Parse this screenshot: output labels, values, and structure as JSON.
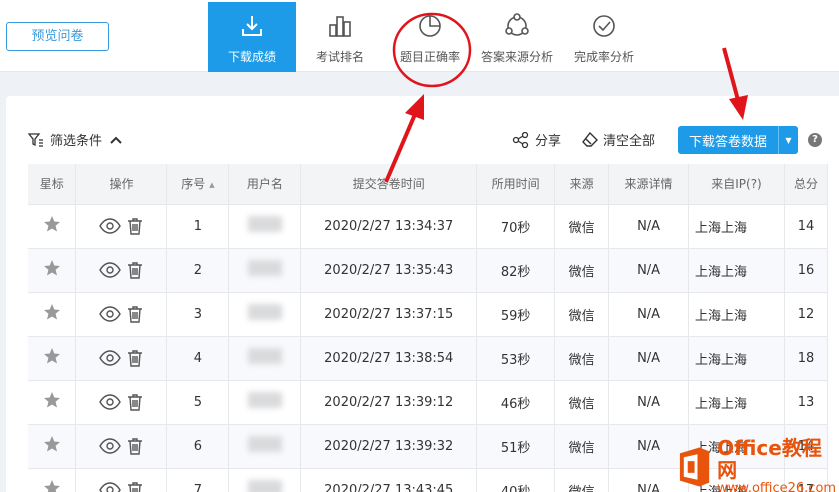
{
  "header": {
    "preview_button": "预览问卷",
    "tabs": [
      {
        "label": "下载成绩",
        "icon": "download-icon",
        "active": true
      },
      {
        "label": "考试排名",
        "icon": "ranking-bars-icon",
        "active": false
      },
      {
        "label": "题目正确率",
        "icon": "pie-chart-icon",
        "active": false
      },
      {
        "label": "答案来源分析",
        "icon": "share-nodes-icon",
        "active": false
      },
      {
        "label": "完成率分析",
        "icon": "check-circle-icon",
        "active": false
      }
    ]
  },
  "toolbar": {
    "filter_label": "筛选条件",
    "share_label": "分享",
    "clear_label": "清空全部",
    "download_label": "下载答卷数据",
    "help_label": "?"
  },
  "table": {
    "headers": [
      "星标",
      "操作",
      "序号",
      "用户名",
      "提交答卷时间",
      "所用时间",
      "来源",
      "来源详情",
      "来自IP(?)",
      "总分"
    ],
    "rows": [
      {
        "no": "1",
        "time": "2020/2/27 13:34:37",
        "used": "70秒",
        "source": "微信",
        "detail": "N/A",
        "ip": "上海上海",
        "score": "14"
      },
      {
        "no": "2",
        "time": "2020/2/27 13:35:43",
        "used": "82秒",
        "source": "微信",
        "detail": "N/A",
        "ip": "上海上海",
        "score": "16"
      },
      {
        "no": "3",
        "time": "2020/2/27 13:37:15",
        "used": "59秒",
        "source": "微信",
        "detail": "N/A",
        "ip": "上海上海",
        "score": "12"
      },
      {
        "no": "4",
        "time": "2020/2/27 13:38:54",
        "used": "53秒",
        "source": "微信",
        "detail": "N/A",
        "ip": "上海上海",
        "score": "18"
      },
      {
        "no": "5",
        "time": "2020/2/27 13:39:12",
        "used": "46秒",
        "source": "微信",
        "detail": "N/A",
        "ip": "上海上海",
        "score": "13"
      },
      {
        "no": "6",
        "time": "2020/2/27 13:39:32",
        "used": "51秒",
        "source": "微信",
        "detail": "N/A",
        "ip": "上海上海",
        "score": "14"
      },
      {
        "no": "7",
        "time": "2020/2/27 13:43:45",
        "used": "40秒",
        "source": "微信",
        "detail": "N/A",
        "ip": "上海上海",
        "score": "17"
      }
    ]
  },
  "watermark": {
    "title": "Office教程网",
    "url": "www.office26.com"
  },
  "colors": {
    "accent": "#1e9be8",
    "annotation": "#e0151c",
    "watermark": "#e8540c"
  }
}
